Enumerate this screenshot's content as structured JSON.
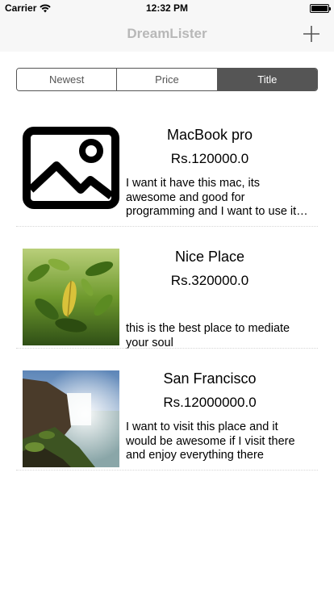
{
  "status_bar": {
    "carrier": "Carrier",
    "time": "12:32 PM"
  },
  "nav": {
    "title": "DreamLister",
    "add_icon": "plus-icon"
  },
  "segments": [
    {
      "label": "Newest",
      "selected": false
    },
    {
      "label": "Price",
      "selected": false
    },
    {
      "label": "Title",
      "selected": true
    }
  ],
  "items": [
    {
      "title": "MacBook pro",
      "price": "Rs.120000.0",
      "description": "I want it have this mac, its awesome and good for programming and I want to use it every day",
      "image": "placeholder-image-icon"
    },
    {
      "title": "Nice Place",
      "price": "Rs.320000.0",
      "description": "this is the best place to mediate your soul",
      "image": "leaves-photo"
    },
    {
      "title": "San Francisco",
      "price": "Rs.12000000.0",
      "description": "I want to visit this place and it would be awesome if I visit there and enjoy everything there",
      "image": "waterfall-photo"
    }
  ]
}
